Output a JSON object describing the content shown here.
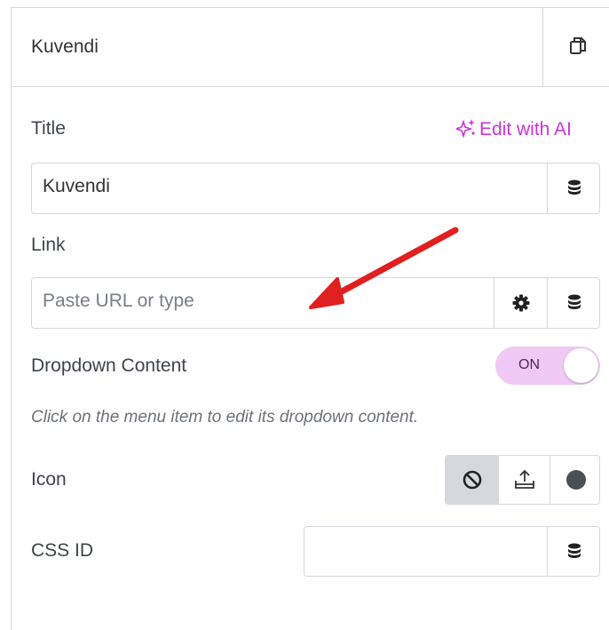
{
  "header": {
    "title": "Kuvendi",
    "copy_icon": "copy-icon"
  },
  "title_field": {
    "label": "Title",
    "value": "Kuvendi",
    "dynamic_icon": "database-icon"
  },
  "ai": {
    "label": "Edit with AI",
    "icon": "sparkle-icon"
  },
  "link_field": {
    "label": "Link",
    "placeholder": "Paste URL or type",
    "settings_icon": "gear-icon",
    "dynamic_icon": "database-icon"
  },
  "dropdown": {
    "label": "Dropdown Content",
    "toggle_text": "ON",
    "enabled": true,
    "hint": "Click on the menu item to edit its dropdown content."
  },
  "icon_setting": {
    "label": "Icon",
    "options": [
      "none-icon",
      "upload-icon",
      "circle-icon"
    ],
    "selected": "none-icon"
  },
  "css_id": {
    "label": "CSS ID",
    "value": "",
    "dynamic_icon": "database-icon"
  },
  "colors": {
    "accent": "#c936d8",
    "toggle_bg": "#f0c9f5",
    "arrow": "#e02020"
  }
}
